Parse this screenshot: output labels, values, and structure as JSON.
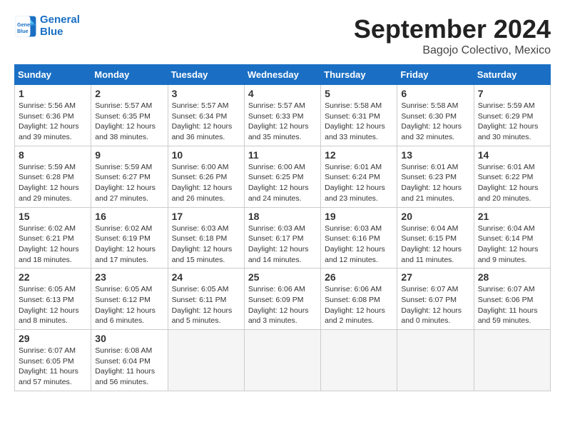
{
  "header": {
    "logo_line1": "General",
    "logo_line2": "Blue",
    "title": "September 2024",
    "location": "Bagojo Colectivo, Mexico"
  },
  "days_of_week": [
    "Sunday",
    "Monday",
    "Tuesday",
    "Wednesday",
    "Thursday",
    "Friday",
    "Saturday"
  ],
  "weeks": [
    [
      {
        "day": "1",
        "detail": "Sunrise: 5:56 AM\nSunset: 6:36 PM\nDaylight: 12 hours\nand 39 minutes."
      },
      {
        "day": "2",
        "detail": "Sunrise: 5:57 AM\nSunset: 6:35 PM\nDaylight: 12 hours\nand 38 minutes."
      },
      {
        "day": "3",
        "detail": "Sunrise: 5:57 AM\nSunset: 6:34 PM\nDaylight: 12 hours\nand 36 minutes."
      },
      {
        "day": "4",
        "detail": "Sunrise: 5:57 AM\nSunset: 6:33 PM\nDaylight: 12 hours\nand 35 minutes."
      },
      {
        "day": "5",
        "detail": "Sunrise: 5:58 AM\nSunset: 6:31 PM\nDaylight: 12 hours\nand 33 minutes."
      },
      {
        "day": "6",
        "detail": "Sunrise: 5:58 AM\nSunset: 6:30 PM\nDaylight: 12 hours\nand 32 minutes."
      },
      {
        "day": "7",
        "detail": "Sunrise: 5:59 AM\nSunset: 6:29 PM\nDaylight: 12 hours\nand 30 minutes."
      }
    ],
    [
      {
        "day": "8",
        "detail": "Sunrise: 5:59 AM\nSunset: 6:28 PM\nDaylight: 12 hours\nand 29 minutes."
      },
      {
        "day": "9",
        "detail": "Sunrise: 5:59 AM\nSunset: 6:27 PM\nDaylight: 12 hours\nand 27 minutes."
      },
      {
        "day": "10",
        "detail": "Sunrise: 6:00 AM\nSunset: 6:26 PM\nDaylight: 12 hours\nand 26 minutes."
      },
      {
        "day": "11",
        "detail": "Sunrise: 6:00 AM\nSunset: 6:25 PM\nDaylight: 12 hours\nand 24 minutes."
      },
      {
        "day": "12",
        "detail": "Sunrise: 6:01 AM\nSunset: 6:24 PM\nDaylight: 12 hours\nand 23 minutes."
      },
      {
        "day": "13",
        "detail": "Sunrise: 6:01 AM\nSunset: 6:23 PM\nDaylight: 12 hours\nand 21 minutes."
      },
      {
        "day": "14",
        "detail": "Sunrise: 6:01 AM\nSunset: 6:22 PM\nDaylight: 12 hours\nand 20 minutes."
      }
    ],
    [
      {
        "day": "15",
        "detail": "Sunrise: 6:02 AM\nSunset: 6:21 PM\nDaylight: 12 hours\nand 18 minutes."
      },
      {
        "day": "16",
        "detail": "Sunrise: 6:02 AM\nSunset: 6:19 PM\nDaylight: 12 hours\nand 17 minutes."
      },
      {
        "day": "17",
        "detail": "Sunrise: 6:03 AM\nSunset: 6:18 PM\nDaylight: 12 hours\nand 15 minutes."
      },
      {
        "day": "18",
        "detail": "Sunrise: 6:03 AM\nSunset: 6:17 PM\nDaylight: 12 hours\nand 14 minutes."
      },
      {
        "day": "19",
        "detail": "Sunrise: 6:03 AM\nSunset: 6:16 PM\nDaylight: 12 hours\nand 12 minutes."
      },
      {
        "day": "20",
        "detail": "Sunrise: 6:04 AM\nSunset: 6:15 PM\nDaylight: 12 hours\nand 11 minutes."
      },
      {
        "day": "21",
        "detail": "Sunrise: 6:04 AM\nSunset: 6:14 PM\nDaylight: 12 hours\nand 9 minutes."
      }
    ],
    [
      {
        "day": "22",
        "detail": "Sunrise: 6:05 AM\nSunset: 6:13 PM\nDaylight: 12 hours\nand 8 minutes."
      },
      {
        "day": "23",
        "detail": "Sunrise: 6:05 AM\nSunset: 6:12 PM\nDaylight: 12 hours\nand 6 minutes."
      },
      {
        "day": "24",
        "detail": "Sunrise: 6:05 AM\nSunset: 6:11 PM\nDaylight: 12 hours\nand 5 minutes."
      },
      {
        "day": "25",
        "detail": "Sunrise: 6:06 AM\nSunset: 6:09 PM\nDaylight: 12 hours\nand 3 minutes."
      },
      {
        "day": "26",
        "detail": "Sunrise: 6:06 AM\nSunset: 6:08 PM\nDaylight: 12 hours\nand 2 minutes."
      },
      {
        "day": "27",
        "detail": "Sunrise: 6:07 AM\nSunset: 6:07 PM\nDaylight: 12 hours\nand 0 minutes."
      },
      {
        "day": "28",
        "detail": "Sunrise: 6:07 AM\nSunset: 6:06 PM\nDaylight: 11 hours\nand 59 minutes."
      }
    ],
    [
      {
        "day": "29",
        "detail": "Sunrise: 6:07 AM\nSunset: 6:05 PM\nDaylight: 11 hours\nand 57 minutes."
      },
      {
        "day": "30",
        "detail": "Sunrise: 6:08 AM\nSunset: 6:04 PM\nDaylight: 11 hours\nand 56 minutes."
      },
      {
        "day": "",
        "detail": ""
      },
      {
        "day": "",
        "detail": ""
      },
      {
        "day": "",
        "detail": ""
      },
      {
        "day": "",
        "detail": ""
      },
      {
        "day": "",
        "detail": ""
      }
    ]
  ]
}
